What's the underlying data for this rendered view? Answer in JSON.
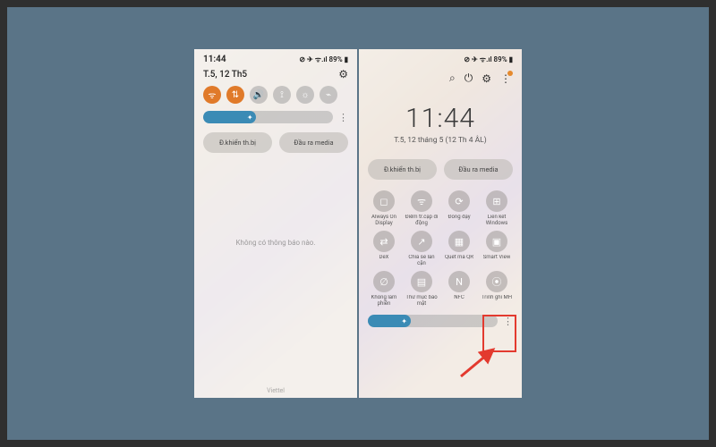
{
  "statusbar": {
    "time": "11:44",
    "indicators": "⊘ ✈ ᯤ.ıl 89% ▮"
  },
  "panel_left": {
    "date": "T.5, 12 Th5",
    "device_control": "Đ.khiển th.bị",
    "media_output": "Đầu ra media",
    "no_notif": "Không có thông báo nào.",
    "carrier": "Viettel",
    "brightness_pct": 36
  },
  "panel_right": {
    "clock_time": "11:44",
    "clock_date": "T.5, 12 tháng 5 (12 Th 4 ÂL)",
    "device_control": "Đ.khiển th.bị",
    "media_output": "Đầu ra media",
    "tiles": [
      {
        "icon": "◻",
        "label": "Always On Display"
      },
      {
        "icon": "ᯤ",
        "label": "Điểm tr.cập di động"
      },
      {
        "icon": "⟳",
        "label": "Đồng dậy"
      },
      {
        "icon": "⊞",
        "label": "Liên kết Windows"
      },
      {
        "icon": "⇄",
        "label": "DeX"
      },
      {
        "icon": "↗",
        "label": "Chia sẻ lân cận"
      },
      {
        "icon": "▦",
        "label": "Quét mã QR"
      },
      {
        "icon": "▣",
        "label": "Smart View"
      },
      {
        "icon": "∅",
        "label": "Không làm phiền"
      },
      {
        "icon": "▤",
        "label": "Thư mục bảo mật"
      },
      {
        "icon": "N",
        "label": "NFC"
      },
      {
        "icon": "⦿",
        "label": "Trình ghi MH"
      }
    ],
    "brightness_pct": 28
  }
}
